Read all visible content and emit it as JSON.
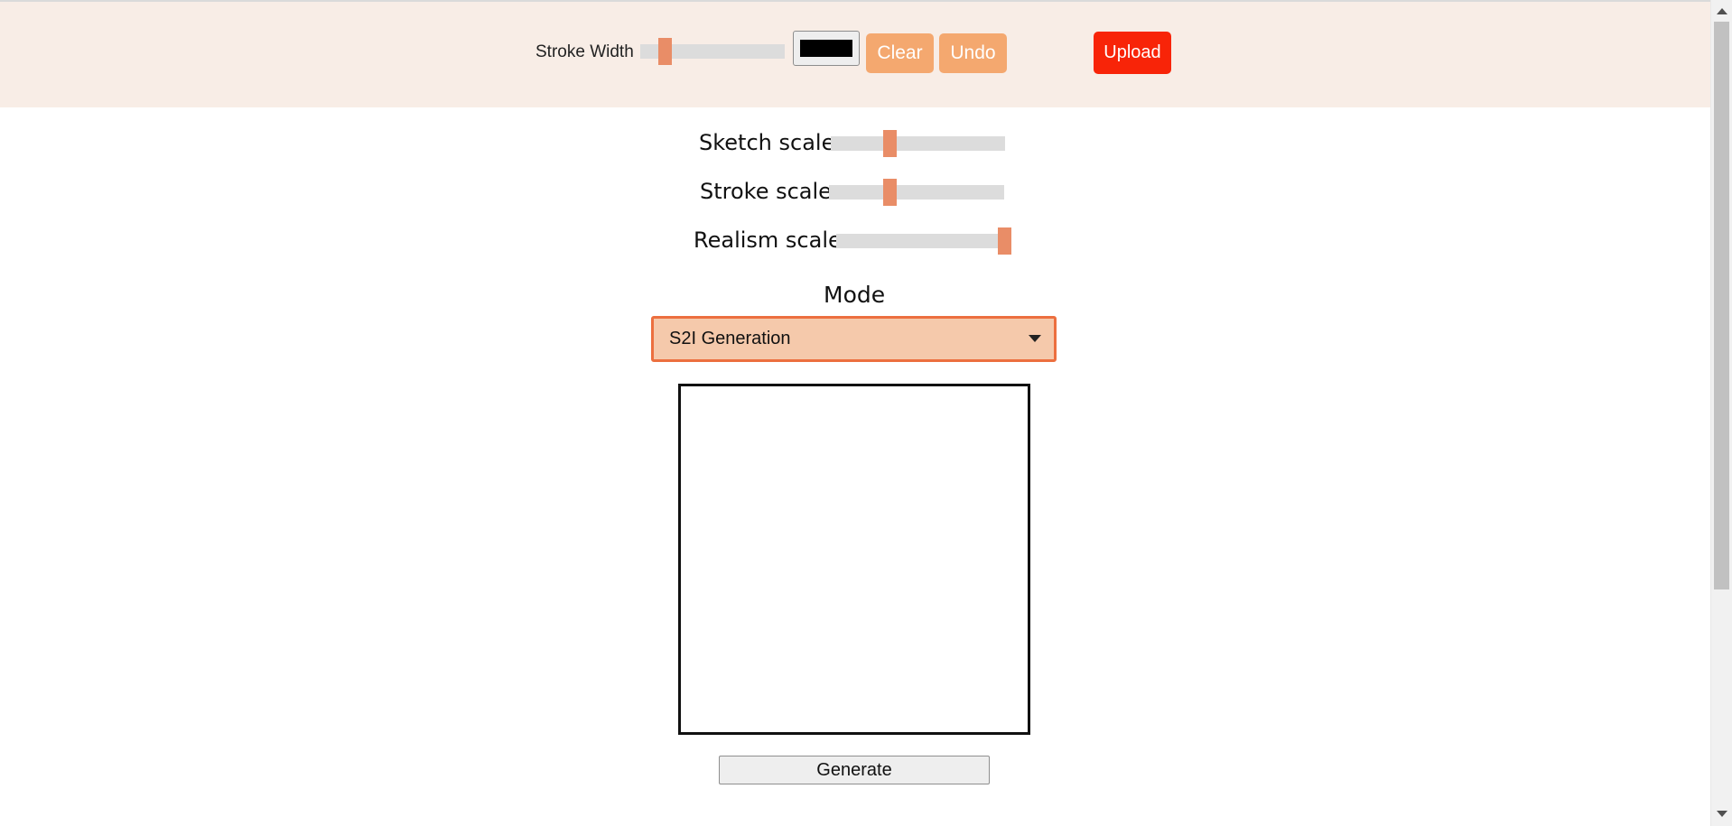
{
  "toolbar": {
    "stroke_width_label": "Stroke Width",
    "stroke_width_level": 0.17,
    "stroke_color": "#000000",
    "clear_label": "Clear",
    "undo_label": "Undo",
    "upload_label": "Upload"
  },
  "scales": {
    "sketch": {
      "label": "Sketch scale",
      "level": 0.34
    },
    "stroke": {
      "label": "Stroke scale",
      "level": 0.35
    },
    "realism": {
      "label": "Realism scale",
      "level": 1.0
    }
  },
  "mode": {
    "label": "Mode",
    "selected": "S2I Generation"
  },
  "generate_label": "Generate",
  "colors": {
    "toolbar_background": "#f8ede6",
    "button_accent": "#f4a86f",
    "upload_button": "#f82408",
    "slider_thumb": "#e98d67",
    "select_background": "#f5c9ab",
    "select_border": "#ec6f3f"
  },
  "icons": {
    "dropdown": "chevron-down-icon",
    "scroll_up": "scroll-up-arrow-icon",
    "scroll_down": "scroll-down-arrow-icon"
  }
}
